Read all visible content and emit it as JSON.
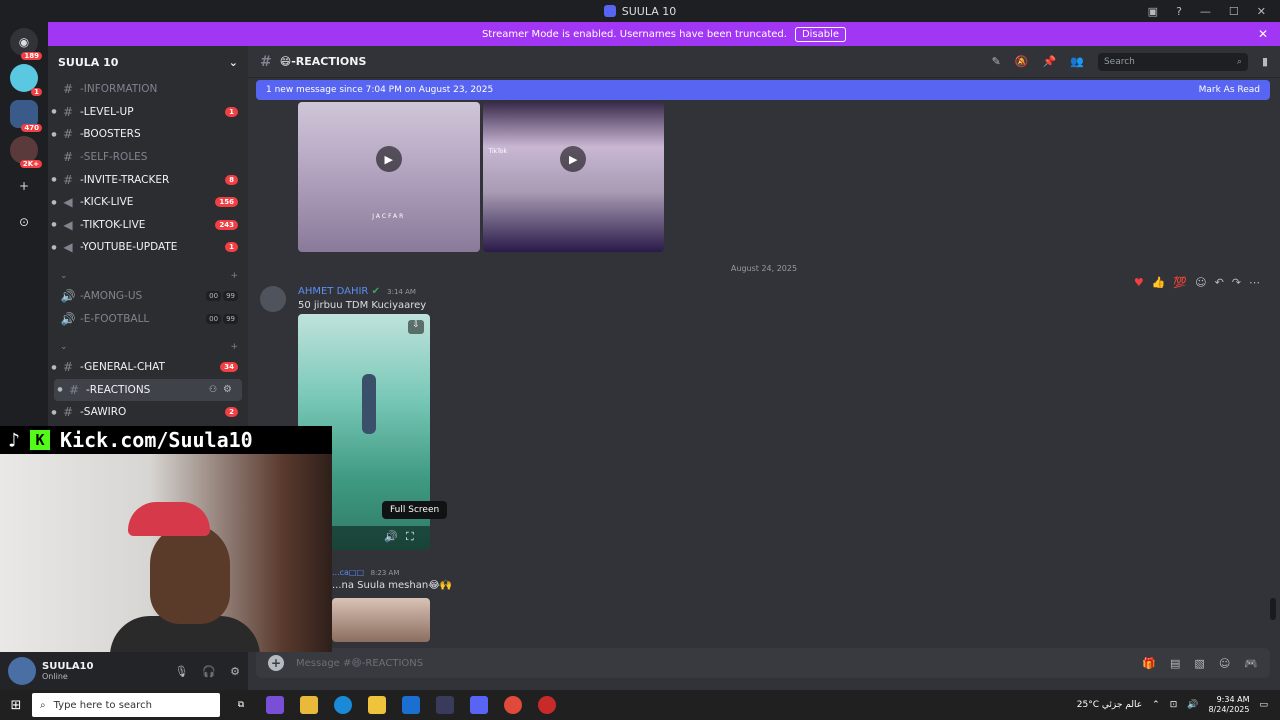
{
  "window": {
    "title": "SUULA 10",
    "controls": [
      "—",
      "☐",
      "✕"
    ]
  },
  "banner": {
    "text": "Streamer Mode is enabled. Usernames have been truncated.",
    "disable_label": "Disable"
  },
  "servers": [
    {
      "icon": "discord-icon",
      "badge": "189"
    },
    {
      "icon": "server-icon",
      "badge": "1"
    },
    {
      "icon": "server-icon",
      "badge": "470"
    },
    {
      "icon": "server-icon",
      "badge": "2K+"
    }
  ],
  "guild": {
    "name": "SUULA 10",
    "channels_top": [
      {
        "name": "-INFORMATION",
        "muted": true,
        "count": "",
        "icon": "hash"
      },
      {
        "name": "-LEVEL-UP",
        "muted": false,
        "count": "1",
        "icon": "hash"
      },
      {
        "name": "-BOOSTERS",
        "muted": false,
        "count": "",
        "icon": "hash"
      },
      {
        "name": "-SELF-ROLES",
        "muted": true,
        "count": "",
        "icon": "hash"
      },
      {
        "name": "-INVITE-TRACKER",
        "muted": false,
        "count": "8",
        "icon": "hash"
      },
      {
        "name": "-KICK-LIVE",
        "muted": false,
        "count": "156",
        "icon": "announce"
      },
      {
        "name": "-TIKTOK-LIVE",
        "muted": false,
        "count": "243",
        "icon": "announce"
      },
      {
        "name": "-YOUTUBE-UPDATE",
        "muted": false,
        "count": "1",
        "icon": "announce"
      }
    ],
    "voice_channels": [
      {
        "name": "-AMONG-US",
        "v1": "00",
        "v2": "99"
      },
      {
        "name": "-E-FOOTBALL",
        "v1": "00",
        "v2": "99"
      }
    ],
    "channels_bottom": [
      {
        "name": "-GENERAL-CHAT",
        "count": "34",
        "active": false
      },
      {
        "name": "-REACTIONS",
        "count": "",
        "active": true
      },
      {
        "name": "-SAWIRO",
        "count": "2",
        "active": false
      }
    ]
  },
  "user": {
    "name": "SUULA10",
    "status": "Online"
  },
  "header": {
    "channel": "😄-REACTIONS",
    "search_placeholder": "Search"
  },
  "new_messages": {
    "text": "1 new message since 7:04 PM on August 23, 2025",
    "mark_read": "Mark As Read"
  },
  "thumbs": {
    "caption1": "JACFAR",
    "tiktok": "TikTok"
  },
  "date_divider": "August 24, 2025",
  "message": {
    "author": "AHMET DAHIR",
    "time": "3:14 AM",
    "text": "50 jirbuu TDM Kuciyaarey",
    "tooltip": "Full Screen"
  },
  "message2": {
    "author": "...ca□□",
    "time": "8:23 AM",
    "text": "...na Suula meshan😂🙌"
  },
  "composer": {
    "placeholder": "Message #😄-REACTIONS"
  },
  "overlay": {
    "kick_text": "Kick.com/Suula10"
  },
  "taskbar": {
    "search_placeholder": "Type here to search",
    "weather": "25°C  عالم جزئي",
    "time": "9:34 AM",
    "date": "8/24/2025"
  }
}
